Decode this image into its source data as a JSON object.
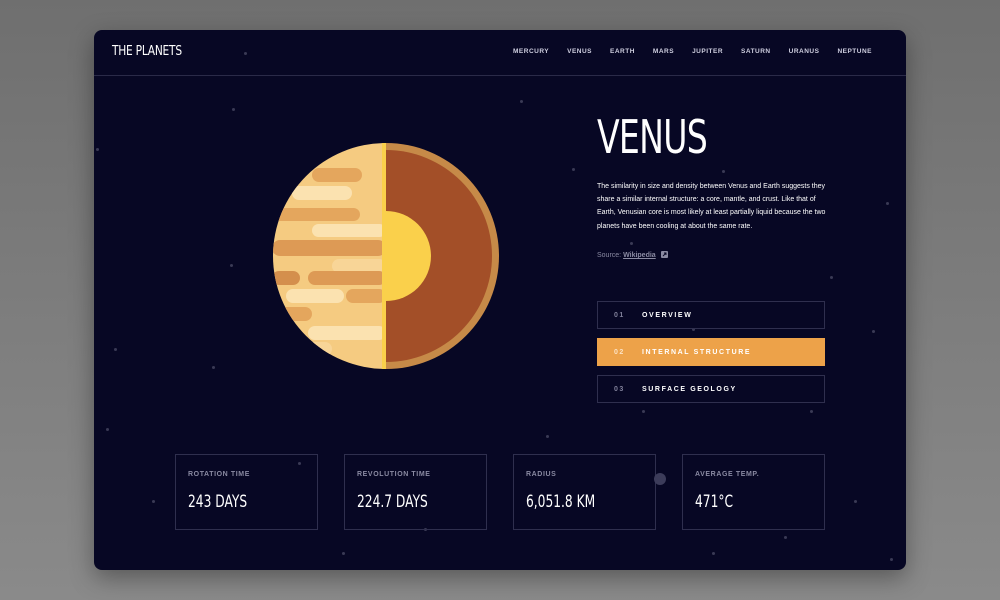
{
  "app": {
    "logo": "THE PLANETS"
  },
  "nav": {
    "items": [
      "MERCURY",
      "VENUS",
      "EARTH",
      "MARS",
      "JUPITER",
      "SATURN",
      "URANUS",
      "NEPTUNE"
    ]
  },
  "planet": {
    "name": "VENUS",
    "description": "The similarity in size and density between Venus and Earth suggests they share a similar internal structure: a core, mantle, and crust. Like that of Earth, Venusian core is most likely at least partially liquid because the two planets have been cooling at about the same rate.",
    "source_prefix": "Source:",
    "source_link": "Wikipedia"
  },
  "tabs": [
    {
      "num": "01",
      "label": "OVERVIEW",
      "active": false
    },
    {
      "num": "02",
      "label": "INTERNAL STRUCTURE",
      "active": true
    },
    {
      "num": "03",
      "label": "SURFACE GEOLOGY",
      "active": false
    }
  ],
  "stats": [
    {
      "label": "ROTATION TIME",
      "value": "243 DAYS"
    },
    {
      "label": "REVOLUTION TIME",
      "value": "224.7 DAYS"
    },
    {
      "label": "RADIUS",
      "value": "6,051.8 KM"
    },
    {
      "label": "AVERAGE TEMP.",
      "value": "471°C"
    }
  ],
  "colors": {
    "background": "#070724",
    "accent": "#eda249",
    "planet_surface": "#f5cb81",
    "mantle": "#a34f28",
    "core": "#fad04b"
  },
  "icons": {
    "source_external": "external-link-icon"
  }
}
